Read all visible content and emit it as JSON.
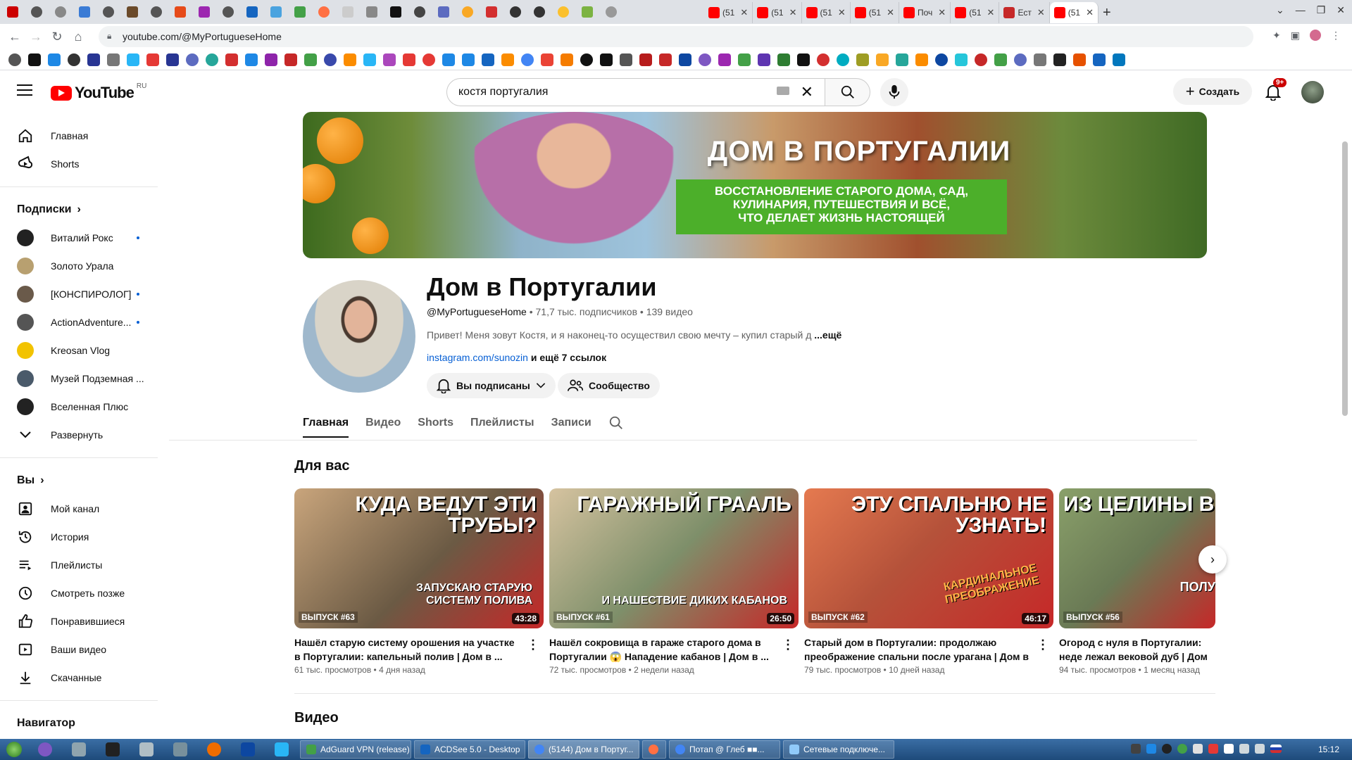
{
  "browser": {
    "url": "youtube.com/@MyPortugueseHome",
    "tabs": [
      {
        "label": "(51",
        "color": "#ff0000"
      },
      {
        "label": "(51",
        "color": "#ff0000"
      },
      {
        "label": "(51",
        "color": "#ff0000"
      },
      {
        "label": "(51",
        "color": "#ff0000"
      },
      {
        "label": "Поч",
        "color": "#ff0000"
      },
      {
        "label": "(51",
        "color": "#ff0000"
      },
      {
        "label": "Ест",
        "color": "#c62828"
      },
      {
        "label": "(51",
        "color": "#ff0000"
      }
    ]
  },
  "youtube": {
    "logo_text": "YouTube",
    "region": "RU",
    "search_value": "костя португалия",
    "create_label": "Создать",
    "notif_badge": "9+"
  },
  "sidebar": {
    "main": [
      {
        "label": "Главная",
        "icon": "home-icon"
      },
      {
        "label": "Shorts",
        "icon": "shorts-icon"
      }
    ],
    "subs_heading": "Подписки",
    "subs": [
      {
        "label": "Виталий Рокс",
        "dot": true,
        "color": "#222"
      },
      {
        "label": "Золото Урала",
        "dot": false,
        "color": "#b8a070"
      },
      {
        "label": "[КОНСПИРОЛОГ]",
        "dot": true,
        "color": "#6a5a4a"
      },
      {
        "label": "ActionAdventure...",
        "dot": true,
        "color": "#555"
      },
      {
        "label": "Kreosan Vlog",
        "dot": false,
        "color": "#f2c300"
      },
      {
        "label": "Музей Подземная ...",
        "dot": false,
        "color": "#4a5a6a"
      },
      {
        "label": "Вселенная Плюс",
        "dot": false,
        "color": "#222"
      }
    ],
    "expand_label": "Развернуть",
    "you_heading": "Вы",
    "you": [
      {
        "label": "Мой канал",
        "icon": "channel-icon"
      },
      {
        "label": "История",
        "icon": "history-icon"
      },
      {
        "label": "Плейлисты",
        "icon": "playlists-icon"
      },
      {
        "label": "Смотреть позже",
        "icon": "watch-later-icon"
      },
      {
        "label": "Понравившиеся",
        "icon": "like-icon"
      },
      {
        "label": "Ваши видео",
        "icon": "your-videos-icon"
      },
      {
        "label": "Скачанные",
        "icon": "download-icon"
      }
    ],
    "nav_heading": "Навигатор"
  },
  "channel": {
    "banner_title": "ДОМ В ПОРТУГАЛИИ",
    "banner_subtitle_1": "ВОССТАНОВЛЕНИЕ СТАРОГО ДОМА, САД,",
    "banner_subtitle_2": "КУЛИНАРИЯ, ПУТЕШЕСТВИЯ И ВСЁ,",
    "banner_subtitle_3": "ЧТО ДЕЛАЕТ ЖИЗНЬ НАСТОЯЩЕЙ",
    "name": "Дом в Португалии",
    "handle": "@MyPortugueseHome",
    "subscribers": "71,7 тыс. подписчиков",
    "videos": "139 видео",
    "description": "Привет! Меня зовут Костя, и я наконец-то осуществил свою мечту – купил старый д",
    "more": "...ещё",
    "link": "instagram.com/sunozin",
    "link_more": "и ещё 7 ссылок",
    "subscribed_label": "Вы подписаны",
    "community_label": "Сообщество"
  },
  "tabs": [
    "Главная",
    "Видео",
    "Shorts",
    "Плейлисты",
    "Записи"
  ],
  "sections": {
    "for_you": "Для вас",
    "videos": "Видео"
  },
  "cards": [
    {
      "thumb_text": "КУДА ВЕДУТ ЭТИ ТРУБЫ?",
      "thumb_sub": "ЗАПУСКАЮ СТАРУЮ СИСТЕМУ ПОЛИВА",
      "episode": "ВЫПУСК #63",
      "duration": "43:28",
      "title": "Нашёл старую систему орошения на участке в Португалии: капельный полив | Дом в ...",
      "views": "61 тыс. просмотров",
      "age": "4 дня назад",
      "bg": "#8a7a60"
    },
    {
      "thumb_text": "ГАРАЖНЫЙ ГРААЛЬ",
      "thumb_sub": "И НАШЕСТВИЕ ДИКИХ КАБАНОВ",
      "episode": "ВЫПУСК #61",
      "duration": "26:50",
      "title": "Нашёл сокровища в гараже старого дома в Португалии 😱 Нападение кабанов | Дом в ...",
      "views": "72 тыс. просмотров",
      "age": "2 недели назад",
      "bg": "#7a8a6a"
    },
    {
      "thumb_text": "ЭТУ СПАЛЬНЮ НЕ УЗНАТЬ!",
      "thumb_sub": "КАРДИНАЛЬНОЕ ПРЕОБРАЖЕНИЕ",
      "episode": "ВЫПУСК #62",
      "duration": "46:17",
      "title": "Старый дом в Португалии: продолжаю преображение спальни после урагана | Дом в ...",
      "views": "79 тыс. просмотров",
      "age": "10 дней назад",
      "bg": "#b5523a"
    },
    {
      "thumb_text": "ИЗ ЦЕЛИНЫ В",
      "thumb_sub": "ПОЛУ",
      "episode": "ВЫПУСК #56",
      "duration": "",
      "title": "Огород с нуля в Португалии: неде лежал вековой дуб | Дом в Порту",
      "views": "94 тыс. просмотров",
      "age": "1 месяц назад",
      "bg": "#6a7a55"
    }
  ],
  "taskbar": {
    "tasks": [
      "AdGuard VPN (release)",
      "ACDSee 5.0 - Desktop",
      "(5144) Дом в Португ...",
      "",
      "Потап @ Глеб ■■...",
      "Сетевые подключе..."
    ],
    "clock": "15:12"
  }
}
